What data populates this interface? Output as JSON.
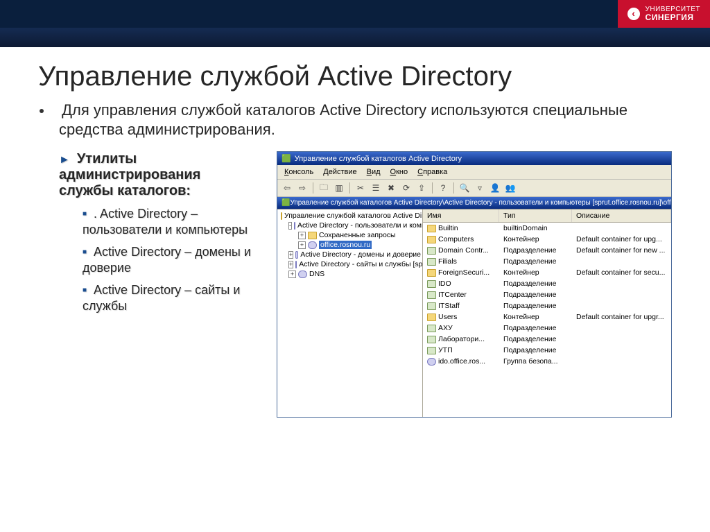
{
  "brand": {
    "line1": "УНИВЕРСИТЕТ",
    "line2": "СИНЕРГИЯ"
  },
  "slide": {
    "title": "Управление службой Active Directory",
    "body": "Для управления службой каталогов Active Directory используются специальные средства администрирования.",
    "subheading": "Утилиты администрирования службы каталогов:",
    "items": [
      ". Active Directory – пользователи и компьютеры",
      "Active Directory – домены и доверие",
      "Active Directory – сайты и службы"
    ]
  },
  "mmc": {
    "title": "Управление службой каталогов Active Directory",
    "menus": [
      "Консоль",
      "Действие",
      "Вид",
      "Окно",
      "Справка"
    ],
    "path": "Управление службой каталогов Active Directory\\Active Directory - пользователи и компьютеры [sprut.office.rosnou.ru]\\office",
    "tree": [
      {
        "level": 0,
        "exp": "",
        "icon": "f",
        "label": "Управление службой каталогов Active Direct"
      },
      {
        "level": 1,
        "exp": "-",
        "icon": "g",
        "label": "Active Directory - пользователи и компью"
      },
      {
        "level": 2,
        "exp": "+",
        "icon": "f",
        "label": "Сохраненные запросы"
      },
      {
        "level": 2,
        "exp": "+",
        "icon": "g",
        "label": "office.rosnou.ru",
        "selected": true
      },
      {
        "level": 1,
        "exp": "+",
        "icon": "g",
        "label": "Active Directory - домены и доверие"
      },
      {
        "level": 1,
        "exp": "+",
        "icon": "g",
        "label": "Active Directory - сайты и службы [sprut.o"
      },
      {
        "level": 1,
        "exp": "+",
        "icon": "g",
        "label": "DNS"
      }
    ],
    "columns": [
      "Имя",
      "Тип",
      "Описание"
    ],
    "rows": [
      {
        "icon": "f",
        "name": "Builtin",
        "type": "builtinDomain",
        "desc": ""
      },
      {
        "icon": "f",
        "name": "Computers",
        "type": "Контейнер",
        "desc": "Default container for upg..."
      },
      {
        "icon": "o",
        "name": "Domain Contr...",
        "type": "Подразделение",
        "desc": "Default container for new ..."
      },
      {
        "icon": "o",
        "name": "Filials",
        "type": "Подразделение",
        "desc": ""
      },
      {
        "icon": "f",
        "name": "ForeignSecuri...",
        "type": "Контейнер",
        "desc": "Default container for secu..."
      },
      {
        "icon": "o",
        "name": "IDO",
        "type": "Подразделение",
        "desc": ""
      },
      {
        "icon": "o",
        "name": "ITCenter",
        "type": "Подразделение",
        "desc": ""
      },
      {
        "icon": "o",
        "name": "ITStaff",
        "type": "Подразделение",
        "desc": ""
      },
      {
        "icon": "f",
        "name": "Users",
        "type": "Контейнер",
        "desc": "Default container for upgr..."
      },
      {
        "icon": "o",
        "name": "АХУ",
        "type": "Подразделение",
        "desc": ""
      },
      {
        "icon": "o",
        "name": "Лаборатори...",
        "type": "Подразделение",
        "desc": ""
      },
      {
        "icon": "o",
        "name": "УТП",
        "type": "Подразделение",
        "desc": ""
      },
      {
        "icon": "g",
        "name": "ido.office.ros...",
        "type": "Группа безопа...",
        "desc": ""
      }
    ]
  }
}
